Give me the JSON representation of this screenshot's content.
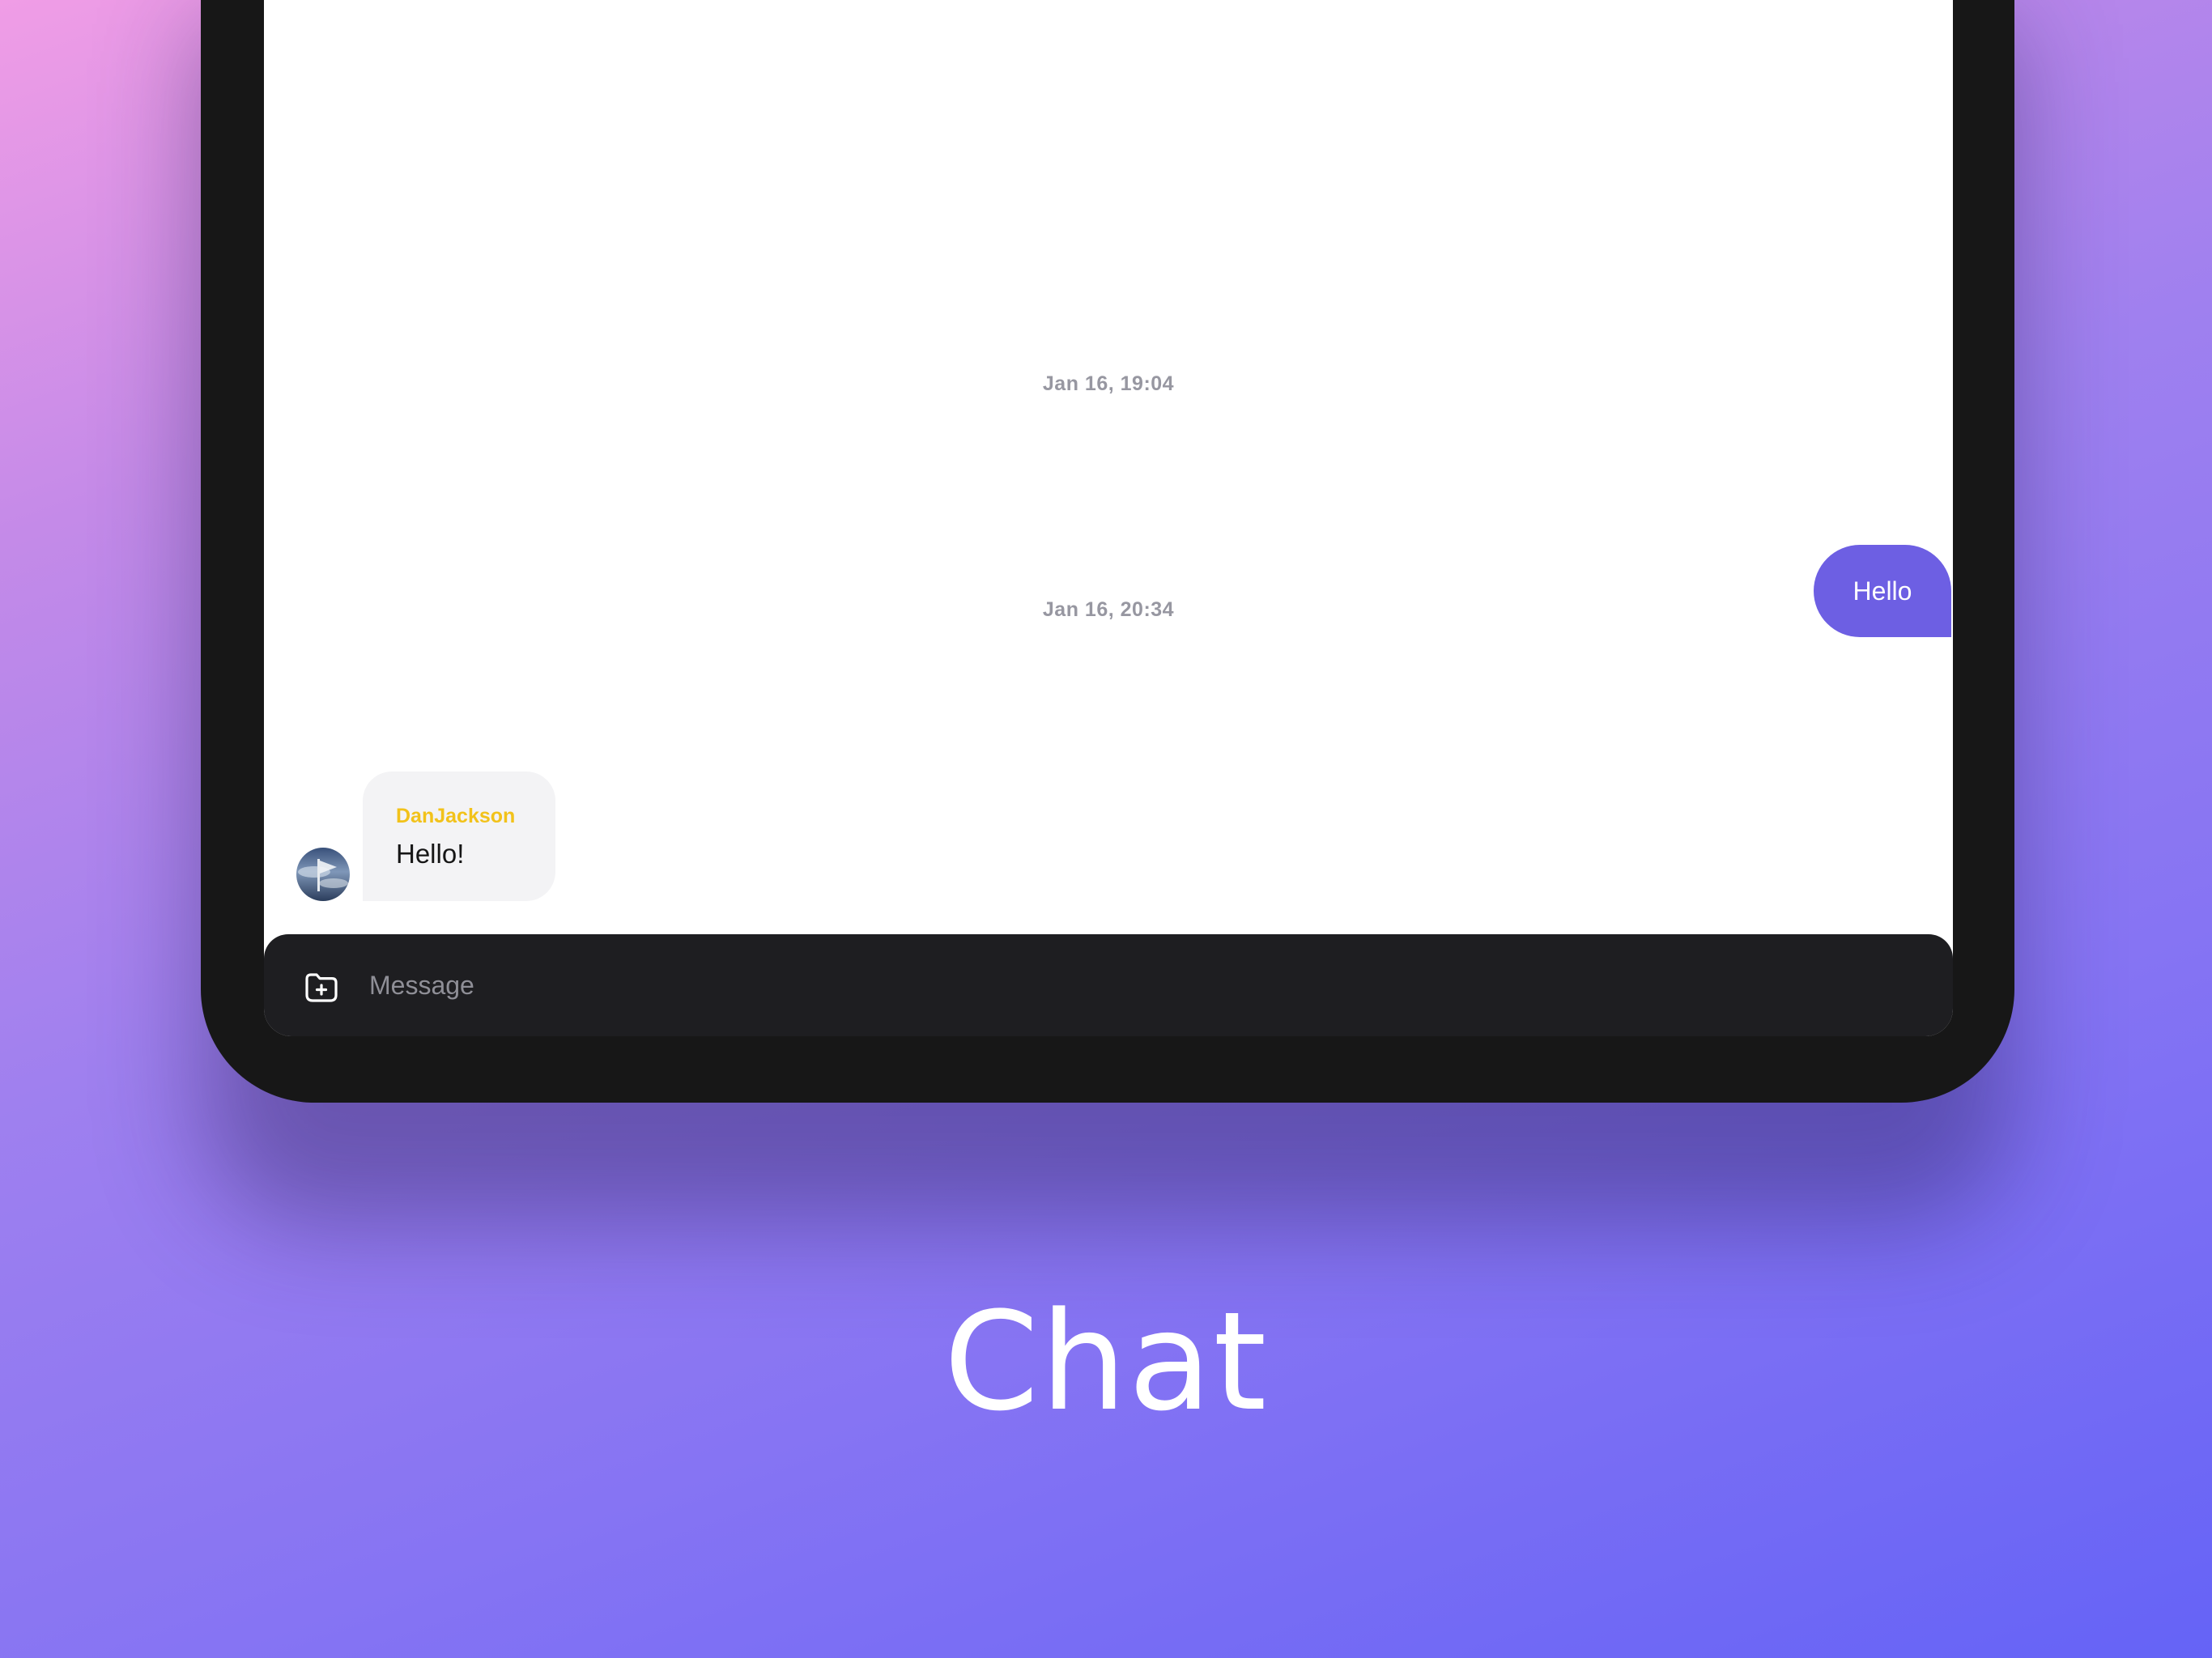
{
  "caption": "Chat",
  "chat": {
    "messages": [
      {
        "type": "timestamp",
        "text": "Jan 16, 19:04"
      },
      {
        "type": "outgoing",
        "text": "Hello"
      },
      {
        "type": "timestamp",
        "text": "Jan 16, 20:34"
      },
      {
        "type": "incoming",
        "sender": "DanJackson",
        "text": "Hello!"
      }
    ]
  },
  "composer": {
    "placeholder": "Message",
    "attach_icon": "folder-plus-icon"
  },
  "colors": {
    "outgoing_bubble": "#6d5fe3",
    "incoming_bubble": "#f3f3f5",
    "sender_name": "#f2c21a",
    "timestamp": "#9797a1",
    "input_bar": "#1e1e21",
    "device_frame": "#171717"
  }
}
